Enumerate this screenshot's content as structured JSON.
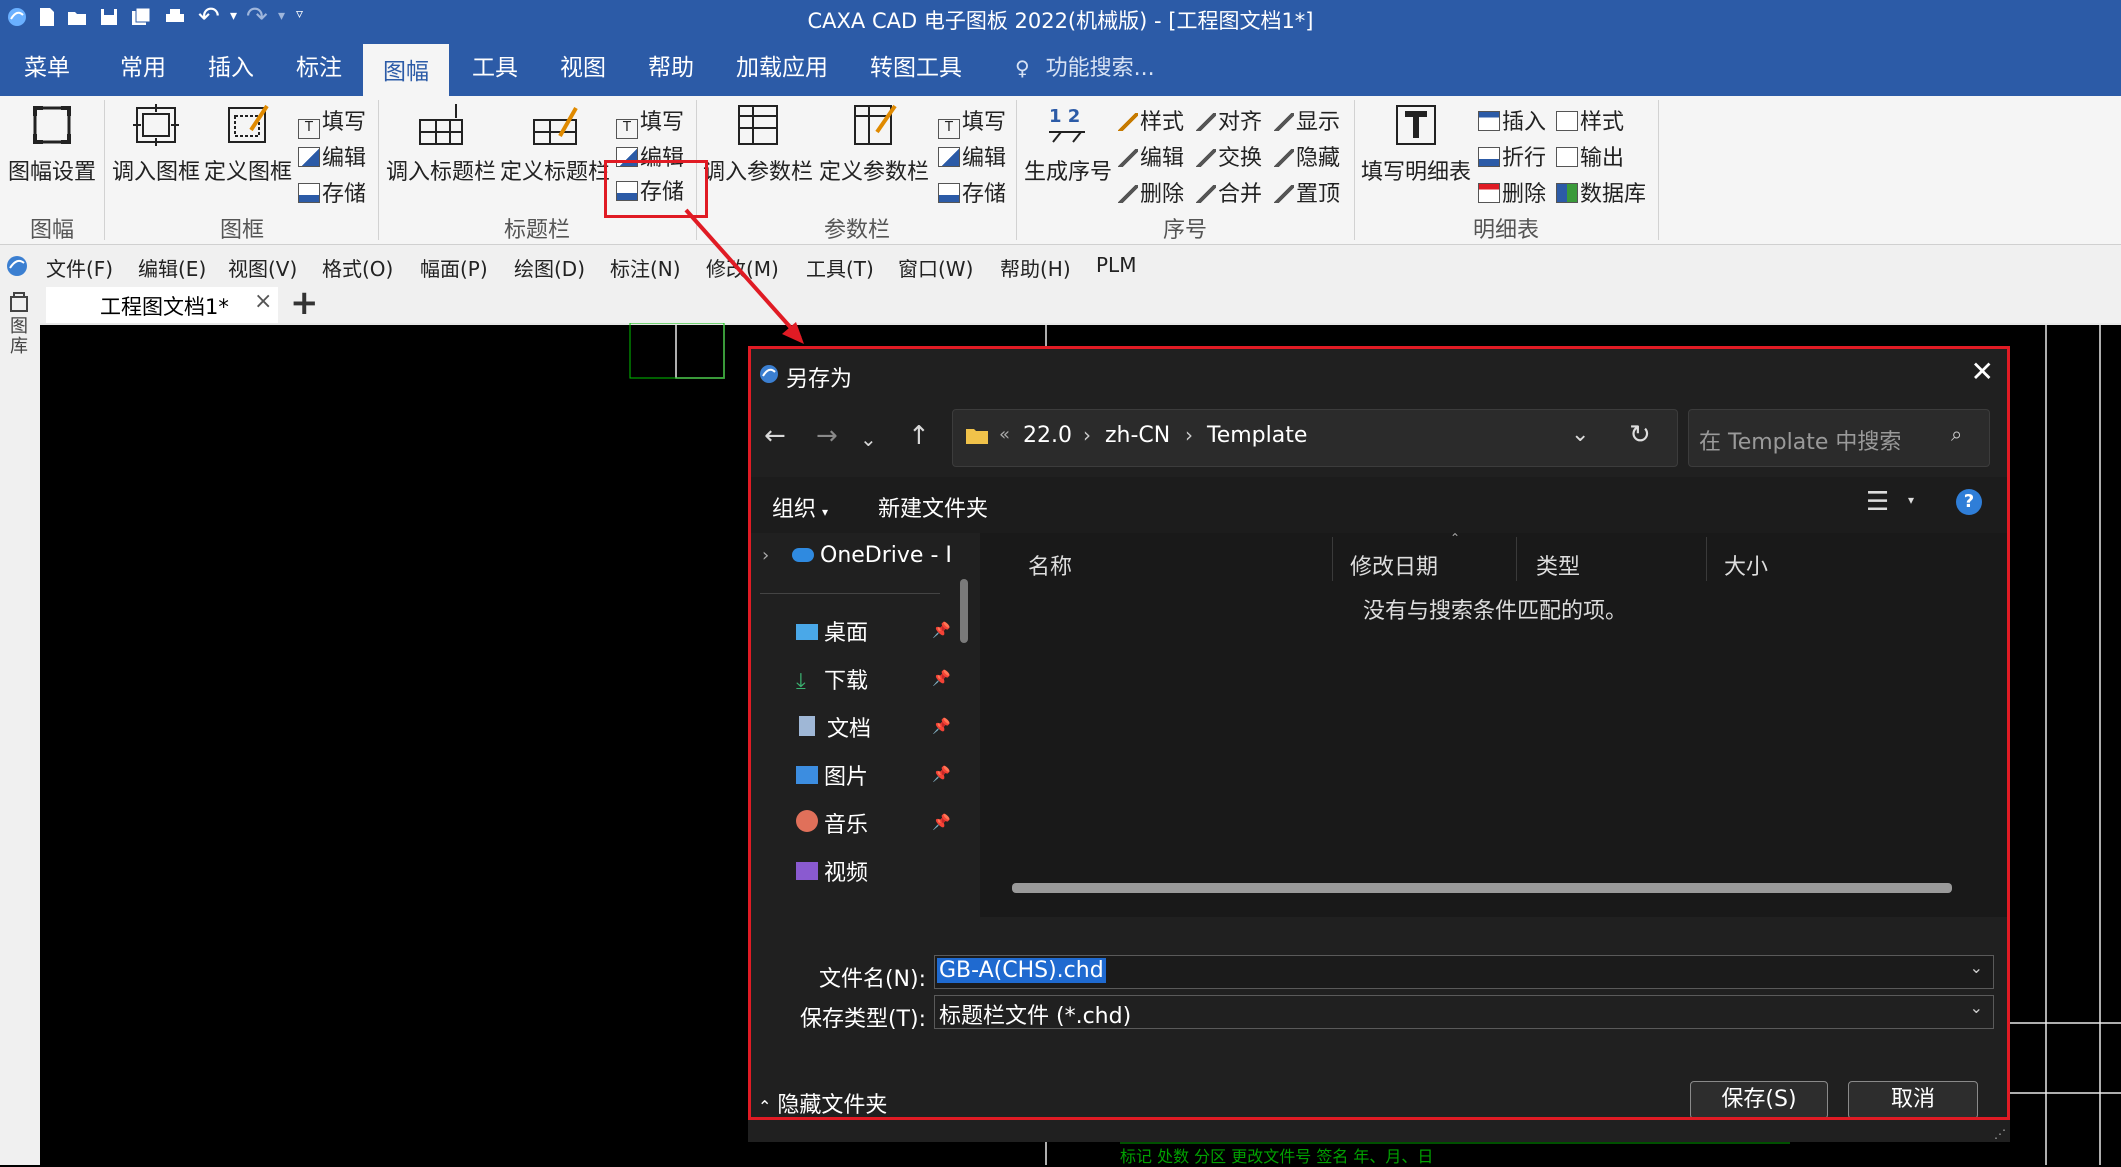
{
  "window": {
    "title": "CAXA CAD 电子图板 2022(机械版) - [工程图文档1*]"
  },
  "ribbon_tabs": [
    "菜单",
    "常用",
    "插入",
    "标注",
    "图幅",
    "工具",
    "视图",
    "帮助",
    "加载应用",
    "转图工具"
  ],
  "active_tab": "图幅",
  "search_placeholder": "功能搜索...",
  "ribbon": {
    "tufu": {
      "setup": "图幅设置",
      "group": "图幅"
    },
    "tukuang": {
      "load": "调入图框",
      "define": "定义图框",
      "fill": "填写",
      "edit": "编辑",
      "store": "存储",
      "group": "图框"
    },
    "biaotilan": {
      "load": "调入标题栏",
      "define": "定义标题栏",
      "fill": "填写",
      "edit": "编辑",
      "store": "存储",
      "group": "标题栏"
    },
    "canshulan": {
      "load": "调入参数栏",
      "define": "定义参数栏",
      "fill": "填写",
      "edit": "编辑",
      "store": "存储",
      "group": "参数栏"
    },
    "xuhao": {
      "generate": "生成序号",
      "style": "样式",
      "edit": "编辑",
      "delete": "删除",
      "align": "对齐",
      "swap": "交换",
      "merge": "合并",
      "show": "显示",
      "hide": "隐藏",
      "top": "置顶",
      "group": "序号",
      "icon_text": "1 2"
    },
    "mingxibiao": {
      "fill": "填写明细表",
      "insert": "插入",
      "fold": "折行",
      "delete": "删除",
      "style": "样式",
      "output": "输出",
      "database": "数据库",
      "group": "明细表"
    }
  },
  "menubar": [
    "文件(F)",
    "编辑(E)",
    "视图(V)",
    "格式(O)",
    "幅面(P)",
    "绘图(D)",
    "标注(N)",
    "修改(M)",
    "工具(T)",
    "窗口(W)",
    "帮助(H)",
    "PLM"
  ],
  "doc_tab": {
    "name": "工程图文档1*",
    "close": "×",
    "add": "+"
  },
  "side_panel_label": "图库",
  "dialog": {
    "title": "另存为",
    "close": "✕",
    "breadcrumb": [
      "22.0",
      "zh-CN",
      "Template"
    ],
    "breadcrumb_prefix": "«",
    "search_placeholder": "在 Template 中搜索",
    "organize": "组织",
    "new_folder": "新建文件夹",
    "help": "?",
    "nav_items": [
      {
        "name": "OneDrive - I",
        "icon": "cloud-icon",
        "pinned": false
      },
      {
        "name": "桌面",
        "icon": "desktop-icon",
        "pinned": true
      },
      {
        "name": "下载",
        "icon": "download-icon",
        "pinned": true
      },
      {
        "name": "文档",
        "icon": "document-icon",
        "pinned": true
      },
      {
        "name": "图片",
        "icon": "picture-icon",
        "pinned": true
      },
      {
        "name": "音乐",
        "icon": "music-icon",
        "pinned": true
      },
      {
        "name": "视频",
        "icon": "video-icon",
        "pinned": false
      }
    ],
    "columns": [
      "名称",
      "修改日期",
      "类型",
      "大小"
    ],
    "empty_message": "没有与搜索条件匹配的项。",
    "filename_label": "文件名(N):",
    "filename_value": "GB-A(CHS).chd",
    "filetype_label": "保存类型(T):",
    "filetype_value": "标题栏文件 (*.chd)",
    "hide_folders": "隐藏文件夹",
    "save": "保存(S)",
    "cancel": "取消"
  },
  "canvas_table_text": "标记 处数 分区 更改文件号 签名 年、月、日",
  "colors": {
    "title_bar": "#2c5ba7",
    "highlight": "#e01b24",
    "canvas": "#000000",
    "dialog": "#202020",
    "cad_green": "#00a000"
  }
}
